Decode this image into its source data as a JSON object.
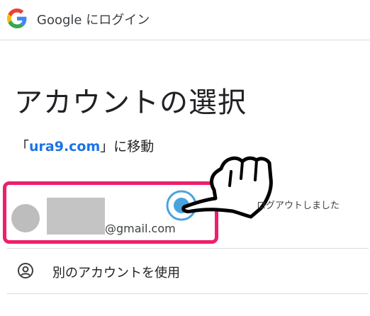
{
  "header": {
    "title": "Google にログイン",
    "logo": "google-g-logo"
  },
  "main": {
    "heading": "アカウントの選択",
    "continue_open": "「",
    "continue_site": "ura9.com",
    "continue_close": "」に移動"
  },
  "account": {
    "email_suffix": "@gmail.com",
    "status": "ログアウトしました",
    "highlight_color": "#ee1e6c"
  },
  "other_account": {
    "label": "別のアカウントを使用",
    "icon": "person-circle-icon"
  },
  "colors": {
    "link": "#1a73e8",
    "divider": "#dadce0",
    "tap": "#4aa3df"
  }
}
